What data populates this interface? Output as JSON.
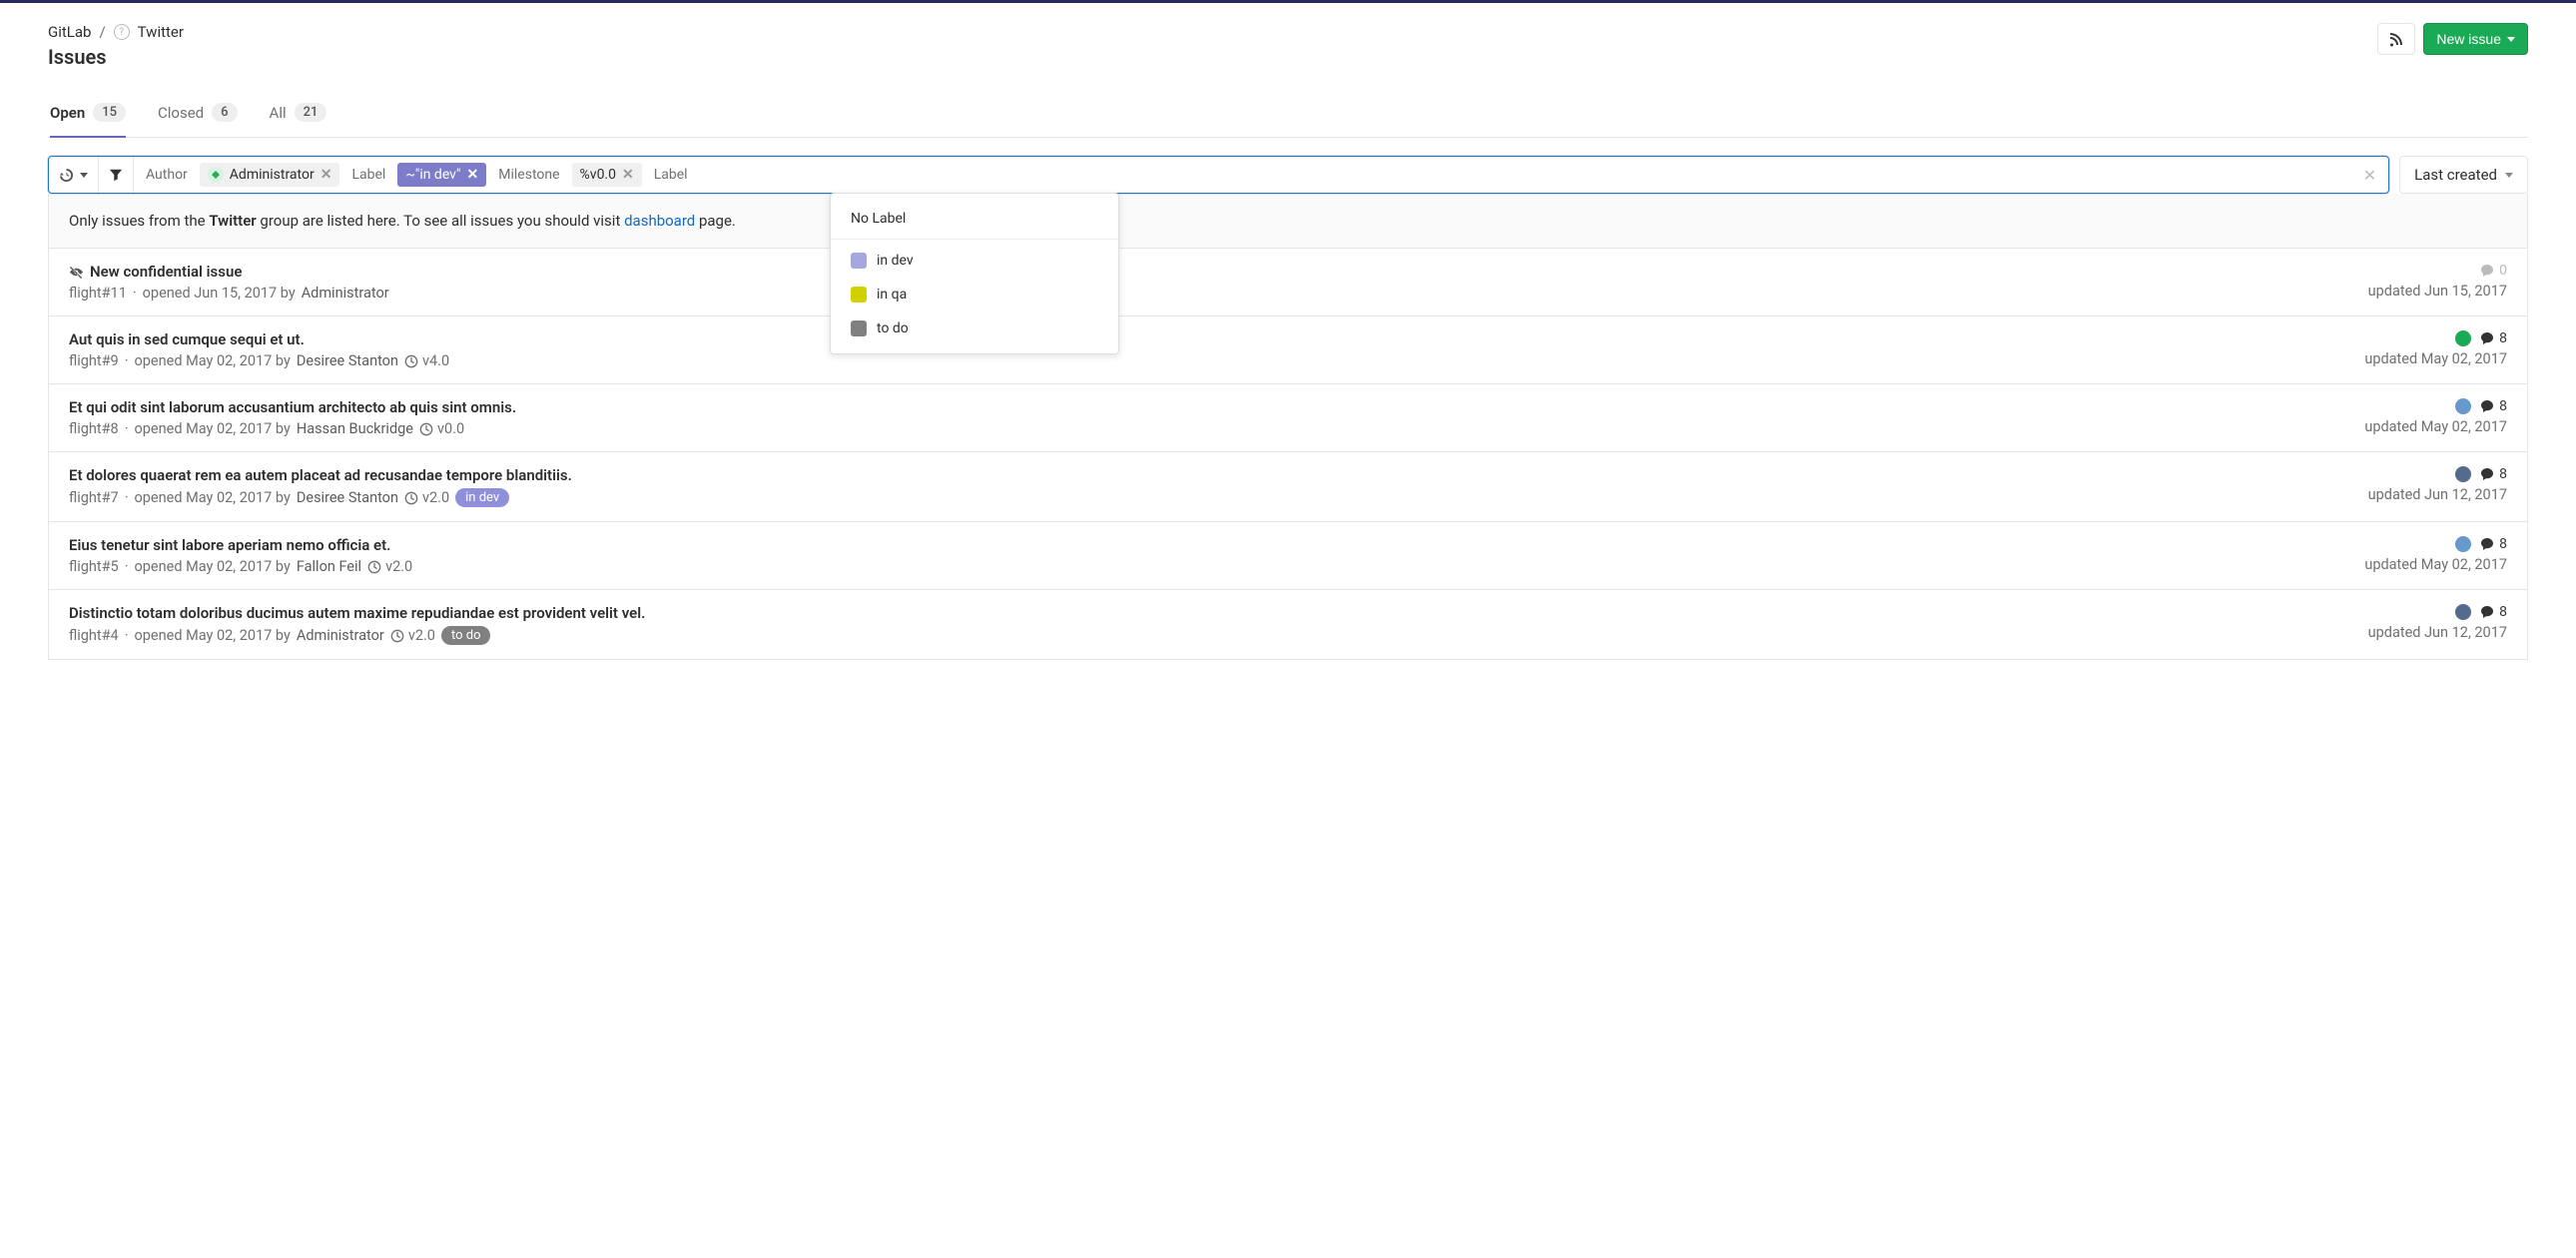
{
  "breadcrumb": {
    "root": "GitLab",
    "group": "Twitter"
  },
  "page_title": "Issues",
  "header": {
    "new_issue": "New issue"
  },
  "tabs": [
    {
      "label": "Open",
      "count": "15",
      "active": true
    },
    {
      "label": "Closed",
      "count": "6",
      "active": false
    },
    {
      "label": "All",
      "count": "21",
      "active": false
    }
  ],
  "filter": {
    "author_label": "Author",
    "author_value": "Administrator",
    "label_label": "Label",
    "label_value": "~\"in dev\"",
    "milestone_label": "Milestone",
    "milestone_value": "%v0.0",
    "label2_label": "Label"
  },
  "sort": {
    "label": "Last created"
  },
  "dropdown": {
    "no_label": "No Label",
    "options": [
      {
        "name": "in dev",
        "color": "#a6a6e0"
      },
      {
        "name": "in qa",
        "color": "#d1d100"
      },
      {
        "name": "to do",
        "color": "#808080"
      }
    ]
  },
  "banner": {
    "pre": "Only issues from the ",
    "group": "Twitter",
    "mid": " group are listed here. To see all issues you should visit ",
    "link": "dashboard",
    "post": " page."
  },
  "issues": [
    {
      "confidential": true,
      "title": "New confidential issue",
      "ref": "flight#11",
      "opened": "opened Jun 15, 2017 by",
      "author": "Administrator",
      "milestone": null,
      "labels": [],
      "comments": "0",
      "comments_muted": true,
      "assignee_color": null,
      "updated": "updated Jun 15, 2017"
    },
    {
      "confidential": false,
      "title": "Aut quis in sed cumque sequi et ut.",
      "ref": "flight#9",
      "opened": "opened May 02, 2017 by",
      "author": "Desiree Stanton",
      "milestone": "v4.0",
      "labels": [],
      "comments": "8",
      "comments_muted": false,
      "assignee_color": "#1aaa55",
      "updated": "updated May 02, 2017"
    },
    {
      "confidential": false,
      "title": "Et qui odit sint laborum accusantium architecto ab quis sint omnis.",
      "ref": "flight#8",
      "opened": "opened May 02, 2017 by",
      "author": "Hassan Buckridge",
      "milestone": "v0.0",
      "labels": [],
      "comments": "8",
      "comments_muted": false,
      "assignee_color": "#6699cc",
      "updated": "updated May 02, 2017"
    },
    {
      "confidential": false,
      "title": "Et dolores quaerat rem ea autem placeat ad recusandae tempore blanditiis.",
      "ref": "flight#7",
      "opened": "opened May 02, 2017 by",
      "author": "Desiree Stanton",
      "milestone": "v2.0",
      "labels": [
        {
          "text": "in dev",
          "bg": "#8f8fdb"
        }
      ],
      "comments": "8",
      "comments_muted": false,
      "assignee_color": "#556b8d",
      "updated": "updated Jun 12, 2017"
    },
    {
      "confidential": false,
      "title": "Eius tenetur sint labore aperiam nemo officia et.",
      "ref": "flight#5",
      "opened": "opened May 02, 2017 by",
      "author": "Fallon Feil",
      "milestone": "v2.0",
      "labels": [],
      "comments": "8",
      "comments_muted": false,
      "assignee_color": "#6699cc",
      "updated": "updated May 02, 2017"
    },
    {
      "confidential": false,
      "title": "Distinctio totam doloribus ducimus autem maxime repudiandae est provident velit vel.",
      "ref": "flight#4",
      "opened": "opened May 02, 2017 by",
      "author": "Administrator",
      "milestone": "v2.0",
      "labels": [
        {
          "text": "to do",
          "bg": "#808080"
        }
      ],
      "comments": "8",
      "comments_muted": false,
      "assignee_color": "#556b8d",
      "updated": "updated Jun 12, 2017"
    }
  ]
}
